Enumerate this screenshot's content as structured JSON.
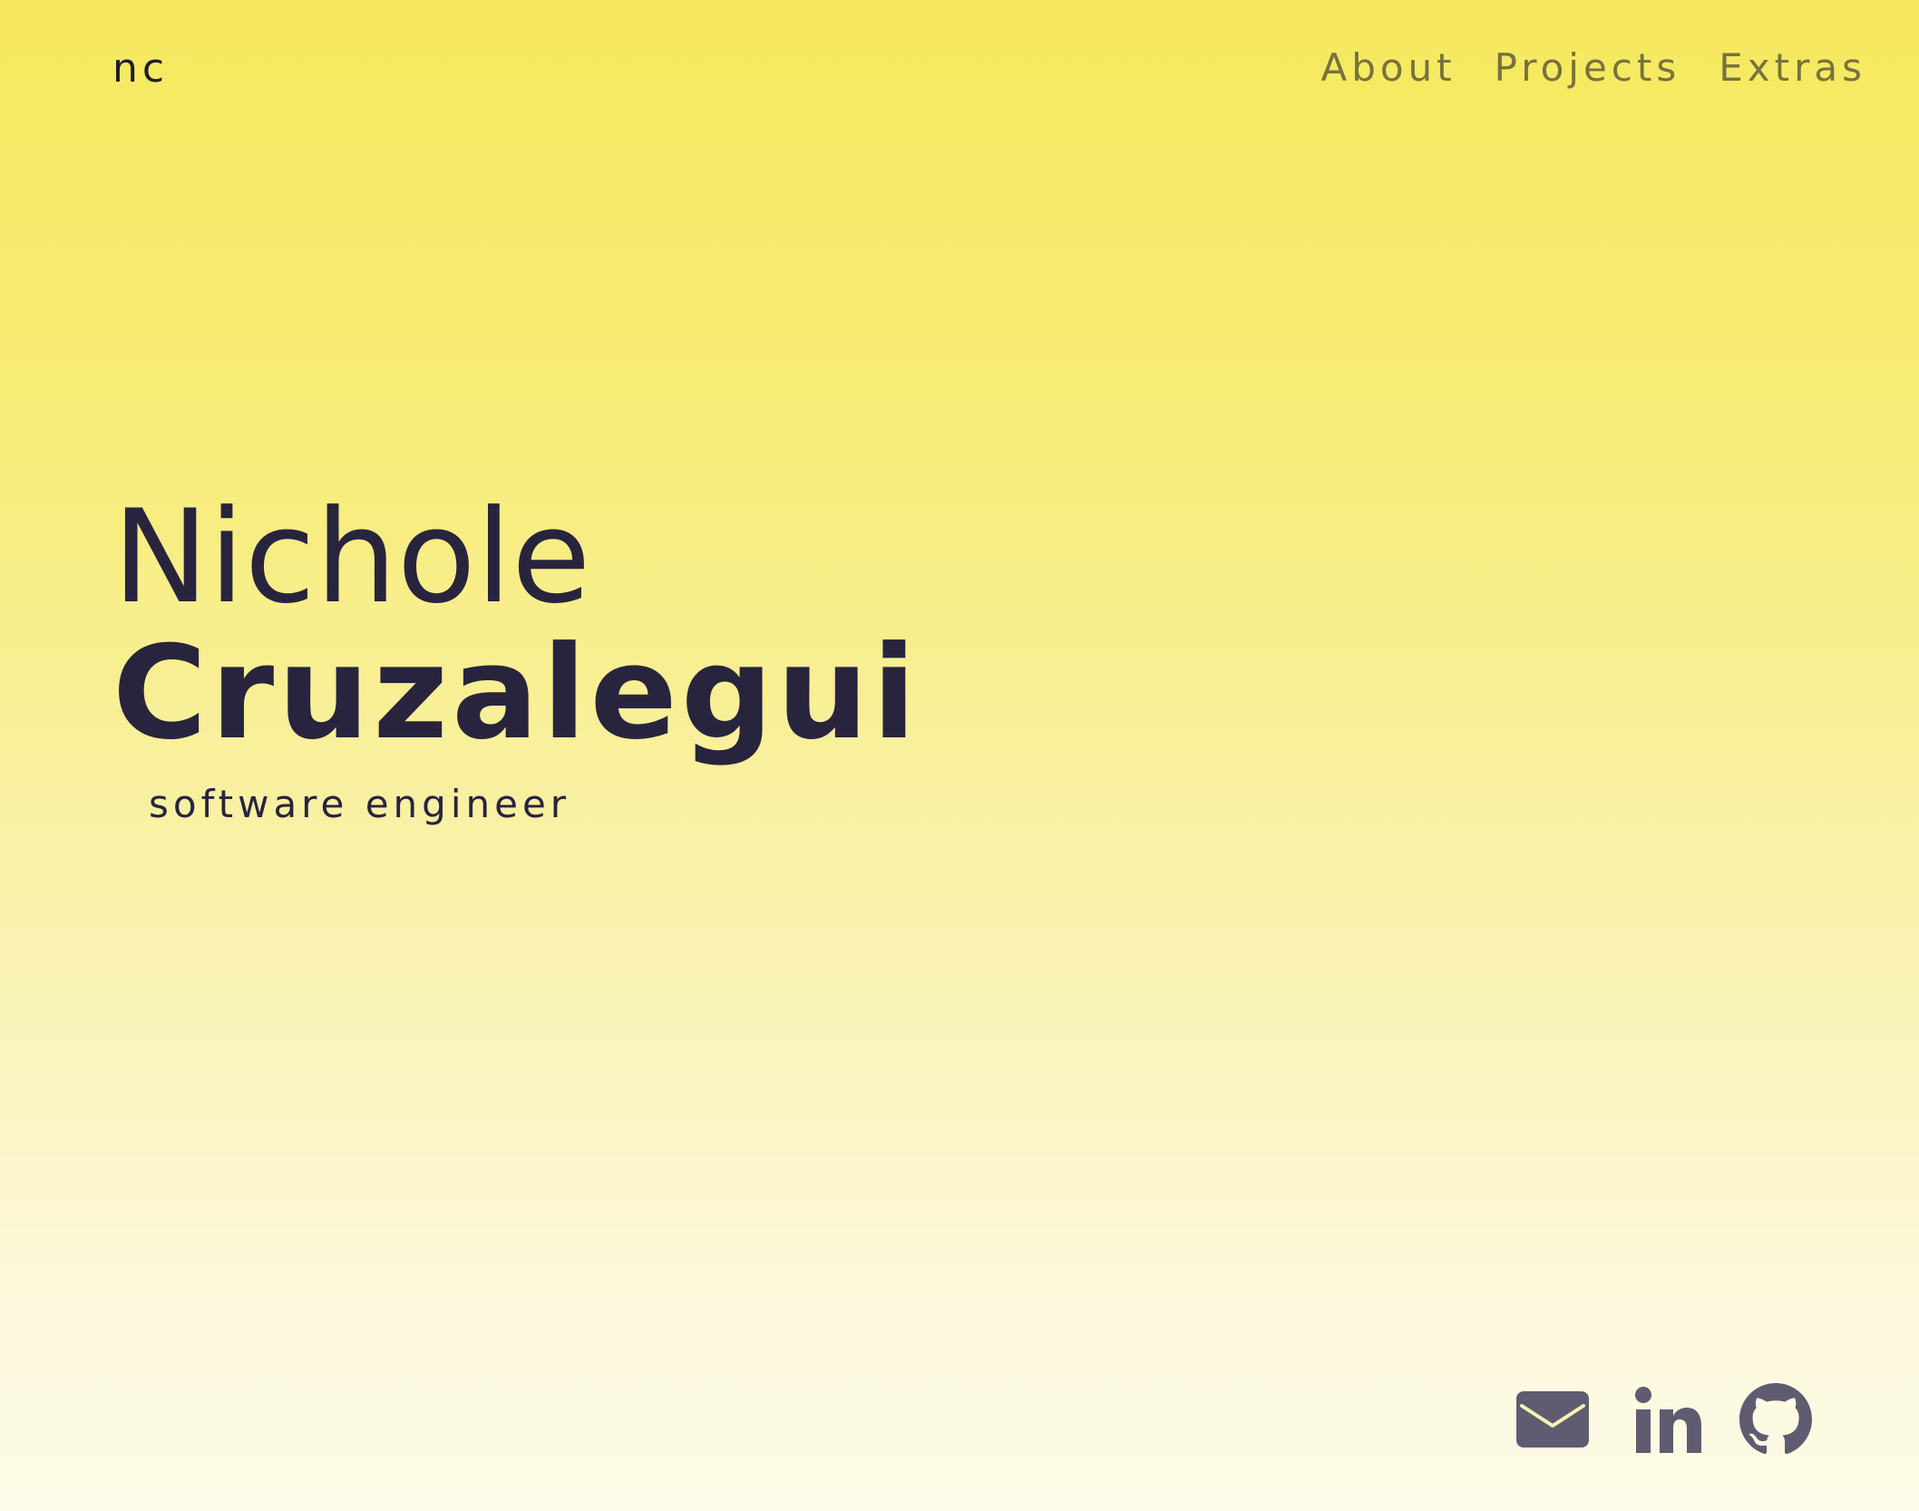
{
  "header": {
    "logo": "nc",
    "nav": [
      {
        "label": "About"
      },
      {
        "label": "Projects"
      },
      {
        "label": "Extras"
      }
    ]
  },
  "hero": {
    "first_name": "Nichole",
    "last_name": "Cruzalegui",
    "subtitle": "software engineer"
  },
  "socials": [
    {
      "icon": "mail-icon"
    },
    {
      "icon": "linkedin-icon"
    },
    {
      "icon": "github-icon"
    }
  ],
  "colors": {
    "background_top": "#f6e95e",
    "background_bottom": "#fdfbe8",
    "text": "#28243e",
    "nav": "#78723e",
    "icons": "#5f5c72"
  }
}
